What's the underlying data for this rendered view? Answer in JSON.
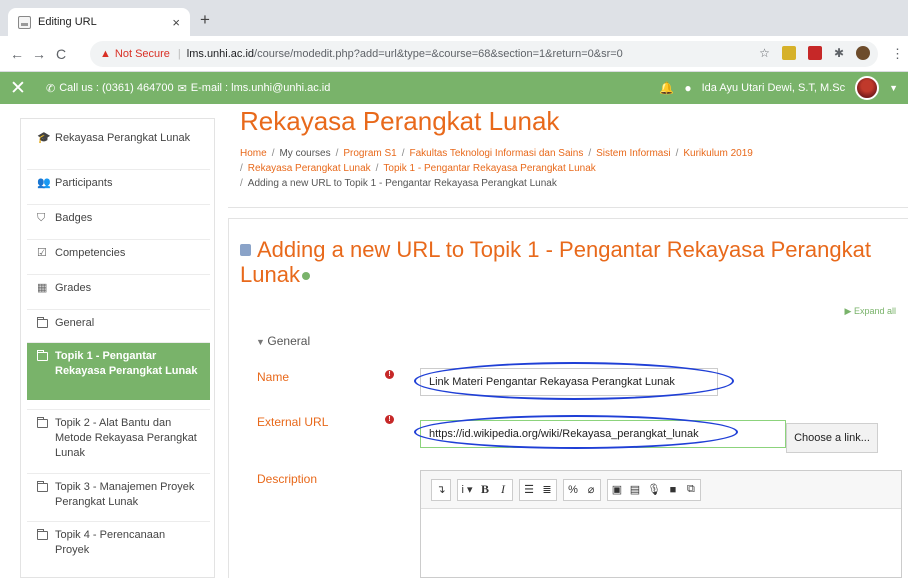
{
  "browser": {
    "tab_title": "Editing URL",
    "tab_close": "×",
    "new_tab": "+",
    "back": "←",
    "forward": "→",
    "reload": "C",
    "warning_icon": "▲",
    "not_secure": "Not Secure",
    "separator": "|",
    "url_host": "lms.unhi.ac.id",
    "url_path": "/course/modedit.php?add=url&type=&course=68&section=1&return=0&sr=0",
    "star_icon": "☆",
    "puzzle_icon": "✱",
    "menu_icon": "⋮"
  },
  "navbar": {
    "close_icon": "✕",
    "phone_icon": "✆",
    "contact_text": "Call us : (0361) 464700",
    "mail_icon": "✉",
    "email_text": "E-mail : lms.unhi@unhi.ac.id",
    "bell_icon": "🔔",
    "chat_icon": "●",
    "user_name": "Ida Ayu Utari Dewi, S.T, M.Sc",
    "caret": "▼",
    "accent": "#79b36a"
  },
  "sidebar": {
    "items": [
      {
        "icon": "graduation-cap-icon",
        "glyph": "🎓",
        "label": "Rekayasa Perangkat Lunak"
      },
      {
        "icon": "users-icon",
        "glyph": "👥",
        "label": "Participants"
      },
      {
        "icon": "shield-icon",
        "glyph": "⛉",
        "label": "Badges"
      },
      {
        "icon": "checkbox-icon",
        "glyph": "☑",
        "label": "Competencies"
      },
      {
        "icon": "table-icon",
        "glyph": "▦",
        "label": "Grades"
      },
      {
        "icon": "folder-icon",
        "label": "General"
      },
      {
        "icon": "folder-icon",
        "label": "Topik 1 - Pengantar Rekayasa Perangkat Lunak"
      },
      {
        "icon": "folder-icon",
        "label": "Topik 2 - Alat Bantu dan Metode Rekayasa Perangkat Lunak"
      },
      {
        "icon": "folder-icon",
        "label": "Topik 3 - Manajemen Proyek Perangkat Lunak"
      },
      {
        "icon": "folder-icon",
        "label": "Topik 4 - Perencanaan Proyek"
      }
    ]
  },
  "main": {
    "course_title": "Rekayasa Perangkat Lunak",
    "breadcrumb": {
      "home": "Home",
      "my_courses": "My courses",
      "program": "Program S1",
      "faculty": "Fakultas Teknologi Informasi dan Sains",
      "dept": "Sistem Informasi",
      "curriculum": "Kurikulum 2019",
      "course": "Rekayasa Perangkat Lunak",
      "topic": "Topik 1 - Pengantar Rekayasa Perangkat Lunak",
      "current": "Adding a new URL to Topik 1 - Pengantar Rekayasa Perangkat Lunak",
      "sep": "/"
    },
    "page_heading": "Adding a new URL to Topik 1 - Pengantar Rekayasa Perangkat Lunak",
    "expand_all": "Expand all",
    "general_legend": "General",
    "name_label": "Name",
    "name_value": "Link Materi Pengantar Rekayasa Perangkat Lunak",
    "url_label": "External URL",
    "url_value": "https://id.wikipedia.org/wiki/Rekayasa_perangkat_lunak",
    "choose_link": "Choose a link...",
    "description_label": "Description",
    "required_glyph": "!"
  },
  "editor_toolbar": {
    "expand": "↴",
    "info": "i ▾",
    "bold": "B",
    "italic": "I",
    "ul": "☰",
    "ol": "≣",
    "link": "%",
    "unlink": "⌀",
    "image": "▣",
    "media": "▤",
    "mic": "🎙",
    "video": "■",
    "copy": "⧉"
  }
}
